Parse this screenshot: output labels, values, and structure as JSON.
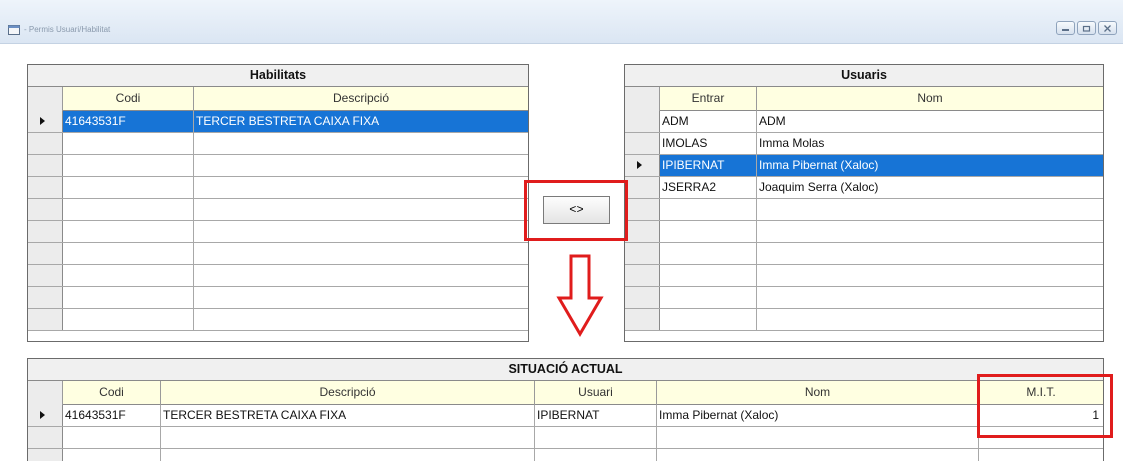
{
  "window": {
    "title": "- Permis Usuari/Habilitat",
    "icon": "app-window-icon",
    "controls": [
      "minimize-icon",
      "restore-icon",
      "close-icon"
    ]
  },
  "habilitats": {
    "caption": "Habilitats",
    "columns": [
      "Codi",
      "Descripció"
    ],
    "rows": [
      {
        "codi": "41643531F",
        "descripcio": "TERCER BESTRETA CAIXA FIXA",
        "selected": true
      }
    ]
  },
  "usuaris": {
    "caption": "Usuaris",
    "columns": [
      "Entrar",
      "Nom"
    ],
    "rows": [
      {
        "entrar": "ADM",
        "nom": "ADM",
        "selected": false
      },
      {
        "entrar": "IMOLAS",
        "nom": "Imma Molas",
        "selected": false
      },
      {
        "entrar": "IPIBERNAT",
        "nom": "Imma Pibernat (Xaloc)",
        "selected": true
      },
      {
        "entrar": "JSERRA2",
        "nom": "Joaquim Serra (Xaloc)",
        "selected": false
      }
    ]
  },
  "swap_button": {
    "label": "<>"
  },
  "situacio": {
    "caption": "SITUACIÓ ACTUAL",
    "columns": [
      "Codi",
      "Descripció",
      "Usuari",
      "Nom",
      "M.I.T."
    ],
    "rows": [
      {
        "codi": "41643531F",
        "descripcio": "TERCER BESTRETA CAIXA FIXA",
        "usuari": "IPIBERNAT",
        "nom": "Imma Pibernat (Xaloc)",
        "mit": "1"
      }
    ]
  },
  "colors": {
    "selection": "#1774d6",
    "header_bg": "#ffffe1",
    "highlight": "#e01c1c"
  }
}
